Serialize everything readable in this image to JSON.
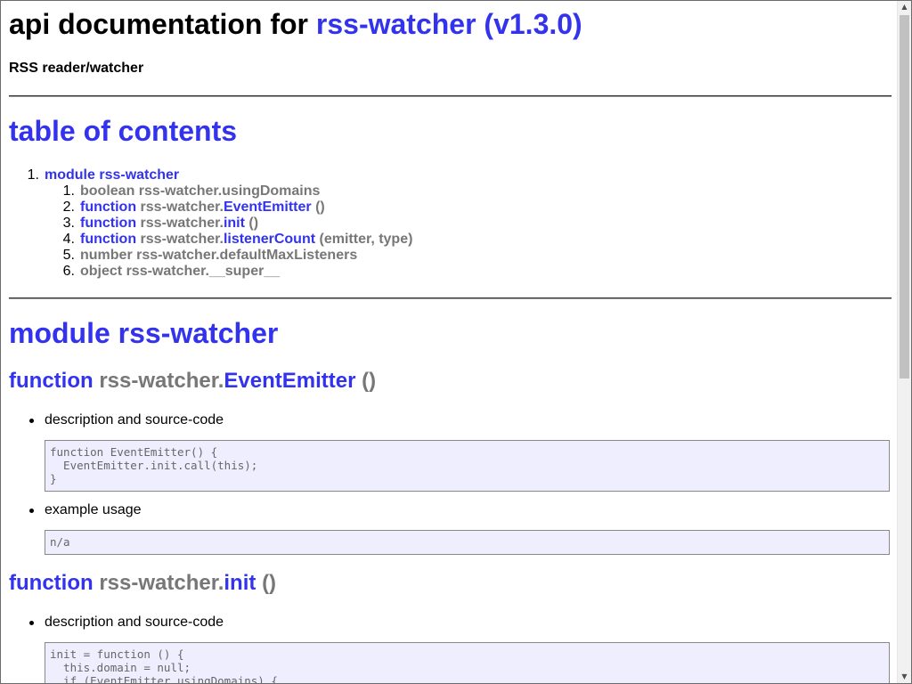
{
  "header": {
    "title_prefix": "api documentation for",
    "package_name": "rss-watcher",
    "version": "(v1.3.0)",
    "subtitle": "RSS reader/watcher"
  },
  "toc": {
    "heading": "table of contents",
    "items": [
      {
        "number": "1.",
        "label": "module rss-watcher"
      }
    ],
    "sub_items": [
      {
        "number": "1.",
        "kind": "boolean",
        "prefix": "rss-watcher.usingDomains",
        "name": "",
        "args": ""
      },
      {
        "number": "2.",
        "kind": "function",
        "prefix": "rss-watcher.",
        "name": "EventEmitter",
        "args": "()"
      },
      {
        "number": "3.",
        "kind": "function",
        "prefix": "rss-watcher.",
        "name": "init",
        "args": "()"
      },
      {
        "number": "4.",
        "kind": "function",
        "prefix": "rss-watcher.",
        "name": "listenerCount",
        "args": "(emitter, type)"
      },
      {
        "number": "5.",
        "kind": "number",
        "prefix": "rss-watcher.defaultMaxListeners",
        "name": "",
        "args": ""
      },
      {
        "number": "6.",
        "kind": "object",
        "prefix": "rss-watcher.__super__",
        "name": "",
        "args": ""
      }
    ]
  },
  "module_section": {
    "heading": "module rss-watcher",
    "functions": [
      {
        "keyword": "function",
        "prefix": "rss-watcher.",
        "name": "EventEmitter",
        "args": "()",
        "desc_label": "description and source-code",
        "source": "function EventEmitter() {\n  EventEmitter.init.call(this);\n}",
        "example_label": "example usage",
        "example": "n/a"
      },
      {
        "keyword": "function",
        "prefix": "rss-watcher.",
        "name": "init",
        "args": "()",
        "desc_label": "description and source-code",
        "source": "init = function () {\n  this.domain = null;\n  if (EventEmitter.usingDomains) {"
      }
    ]
  },
  "colors": {
    "link": "#3333ee",
    "muted": "#777777",
    "code_background": "#eeeeff"
  },
  "icons": {
    "scroll_up": "triangle-up-icon",
    "scroll_down": "triangle-down-icon"
  }
}
